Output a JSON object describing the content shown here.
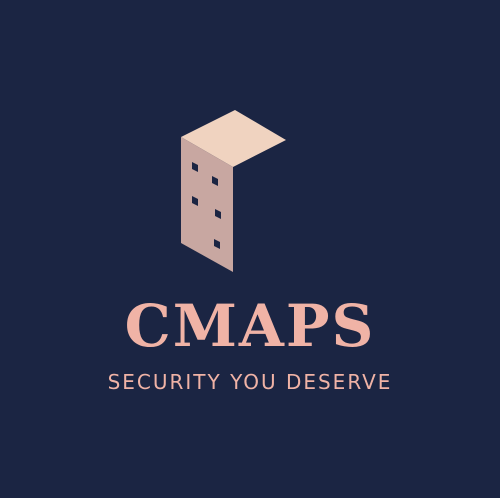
{
  "brand": {
    "name": "CMAPS",
    "tagline": "SECURITY YOU DESERVE"
  },
  "logo": {
    "icon": "isometric-building-icon"
  },
  "colors": {
    "background": "#1b2543",
    "accent": "#f0b3a6",
    "building_top": "#f0d3c0",
    "building_side": "#c8a7a1",
    "windows": "#1b2543"
  }
}
